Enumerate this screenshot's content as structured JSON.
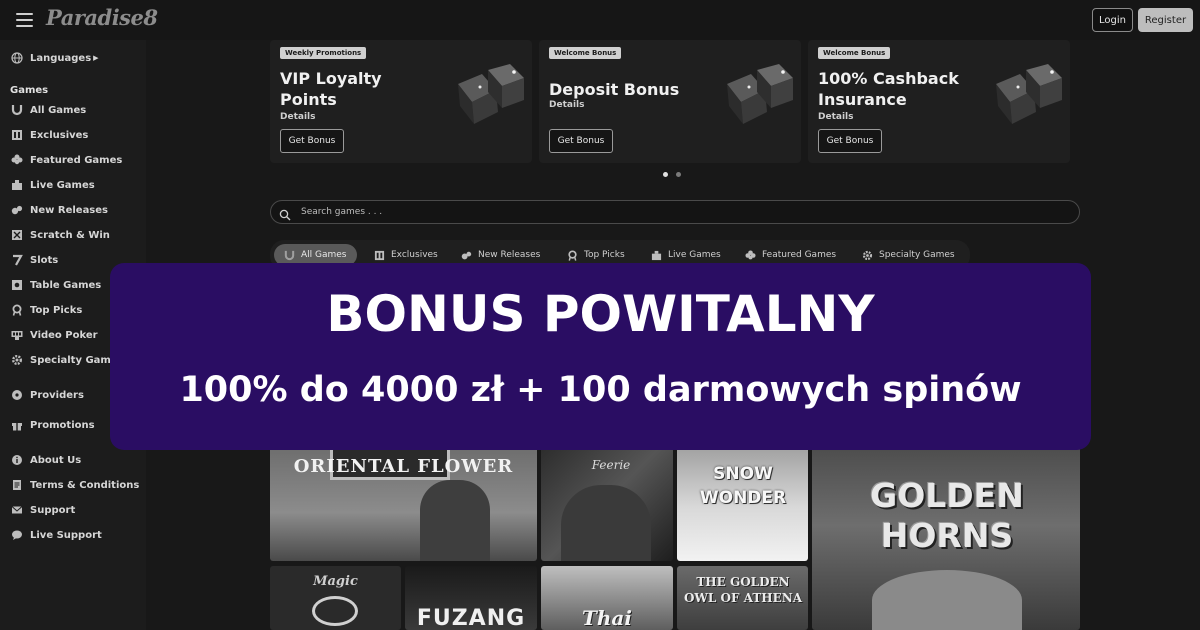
{
  "header": {
    "logo_text": "Paradise8",
    "login_label": "Login",
    "register_label": "Register"
  },
  "sidebar": {
    "languages_label": "Languages",
    "games_heading": "Games",
    "game_items": [
      {
        "label": "All Games",
        "icon": "horseshoe-icon"
      },
      {
        "label": "Exclusives",
        "icon": "exclusive-icon"
      },
      {
        "label": "Featured Games",
        "icon": "clover-icon"
      },
      {
        "label": "Live Games",
        "icon": "live-icon"
      },
      {
        "label": "New Releases",
        "icon": "new-icon"
      },
      {
        "label": "Scratch & Win",
        "icon": "scratch-icon"
      },
      {
        "label": "Slots",
        "icon": "seven-icon"
      },
      {
        "label": "Table Games",
        "icon": "table-icon"
      },
      {
        "label": "Top Picks",
        "icon": "award-icon"
      },
      {
        "label": "Video Poker",
        "icon": "poker-icon"
      },
      {
        "label": "Specialty Games",
        "icon": "gear-icon"
      }
    ],
    "providers_label": "Providers",
    "promotions_label": "Promotions",
    "info_items": [
      {
        "label": "About Us",
        "icon": "info-icon"
      },
      {
        "label": "Terms & Conditions",
        "icon": "document-icon"
      },
      {
        "label": "Support",
        "icon": "mail-icon"
      },
      {
        "label": "Live Support",
        "icon": "chat-icon"
      }
    ]
  },
  "promos": [
    {
      "tag": "Weekly Promotions",
      "title": "VIP Loyalty Points",
      "details": "Details",
      "button": "Get Bonus",
      "icon": "dice-icon"
    },
    {
      "tag": "Welcome Bonus",
      "title": "Deposit Bonus",
      "details": "Details",
      "button": "Get Bonus",
      "icon": "dice-icon"
    },
    {
      "tag": "Welcome Bonus",
      "title": "100% Cashback Insurance",
      "details": "Details",
      "button": "Get Bonus",
      "icon": "dice-icon"
    }
  ],
  "carousel": {
    "pages": 2,
    "active_page": 1
  },
  "search": {
    "placeholder": "Search games . . ."
  },
  "tabs": [
    {
      "label": "All Games",
      "icon": "horseshoe-icon",
      "active": true
    },
    {
      "label": "Exclusives",
      "icon": "exclusive-icon"
    },
    {
      "label": "New Releases",
      "icon": "new-icon"
    },
    {
      "label": "Top Picks",
      "icon": "award-icon"
    },
    {
      "label": "Live Games",
      "icon": "live-icon"
    },
    {
      "label": "Featured Games",
      "icon": "clover-icon"
    },
    {
      "label": "Specialty Games",
      "icon": "gear-icon"
    }
  ],
  "games": [
    {
      "title": "ORIENTAL FLOWER"
    },
    {
      "title": "Feerie"
    },
    {
      "title": "SNOW WONDER"
    },
    {
      "title": "GOLDEN HORNS"
    },
    {
      "title": "Magic"
    },
    {
      "title": "FUZANG"
    },
    {
      "title": "Thai"
    },
    {
      "title": "THE GOLDEN OWL OF ATHENA"
    }
  ],
  "banner": {
    "headline": "BONUS POWITALNY",
    "subline": "100% do 4000 zł + 100 darmowych spinów"
  },
  "colors": {
    "background": "#181818",
    "banner": "#2a0d63",
    "banner_text": "#ffffff"
  }
}
